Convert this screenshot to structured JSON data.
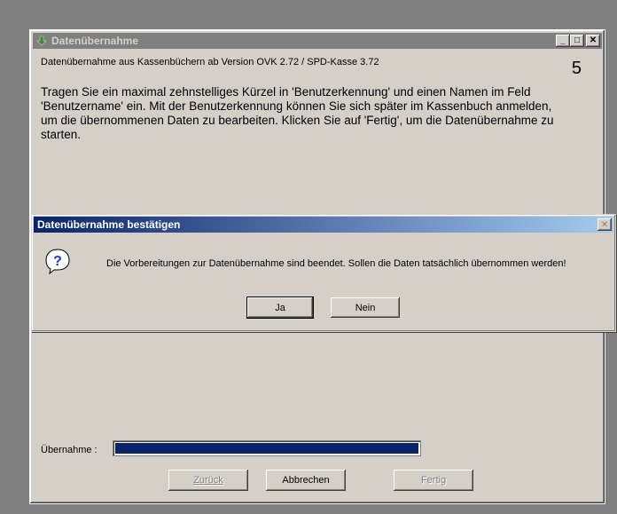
{
  "window": {
    "title": "Datenübernahme",
    "controls": {
      "minimize": "_",
      "maximize": "□",
      "close": "✕"
    },
    "subtitle": "Datenübernahme aus Kassenbüchern ab Version OVK 2.72 / SPD-Kasse 3.72",
    "step_number": "5",
    "instructions": "Tragen Sie ein maximal zehnstelliges Kürzel in 'Benutzerkennung' und einen Namen im Feld 'Benutzername' ein. Mit der Benutzerkennung können Sie sich später im Kassenbuch anmelden, um die übernommenen Daten zu bearbeiten. Klicken Sie auf 'Fertig', um die Datenübernahme zu starten.",
    "progress": {
      "label": "Übernahme :",
      "value_percent": 100
    },
    "buttons": {
      "back": "Zurück",
      "cancel": "Abbrechen",
      "finish": "Fertig"
    }
  },
  "dialog": {
    "title": "Datenübernahme bestätigen",
    "close": "✕",
    "message": "Die Vorbereitungen zur Datenübernahme sind beendet. Sollen die Daten tatsächlich übernommen werden!",
    "buttons": {
      "yes": "Ja",
      "no": "Nein"
    }
  },
  "colors": {
    "dialog_title_start": "#0a246a",
    "dialog_title_end": "#a6caf0",
    "progress_fill": "#0a246a",
    "inactive_title": "#808080"
  }
}
